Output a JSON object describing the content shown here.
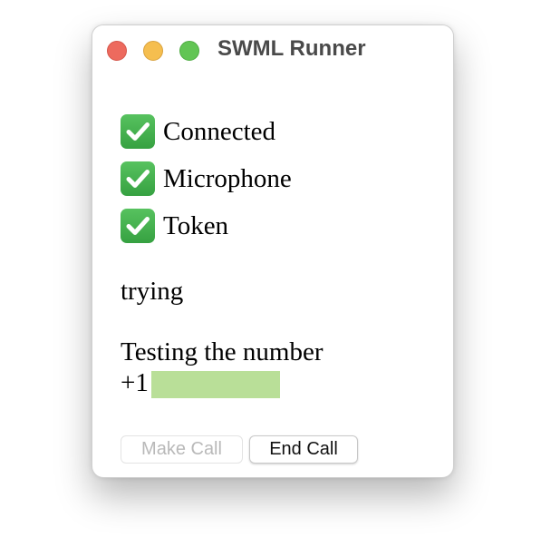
{
  "window": {
    "title": "SWML Runner"
  },
  "status": [
    {
      "icon": "check-mark-icon",
      "label": "Connected"
    },
    {
      "icon": "check-mark-icon",
      "label": "Microphone"
    },
    {
      "icon": "check-mark-icon",
      "label": "Token"
    }
  ],
  "call_state": "trying",
  "message": {
    "line1": "Testing the number",
    "line2": "+1          0"
  },
  "buttons": {
    "make_call": "Make Call",
    "end_call": "End Call"
  },
  "colors": {
    "check_green": "#3fb04a",
    "redaction_green": "#b9df98",
    "close_red": "#ed6a5e",
    "minimize_yellow": "#f5be4f",
    "maximize_green": "#62c554"
  }
}
